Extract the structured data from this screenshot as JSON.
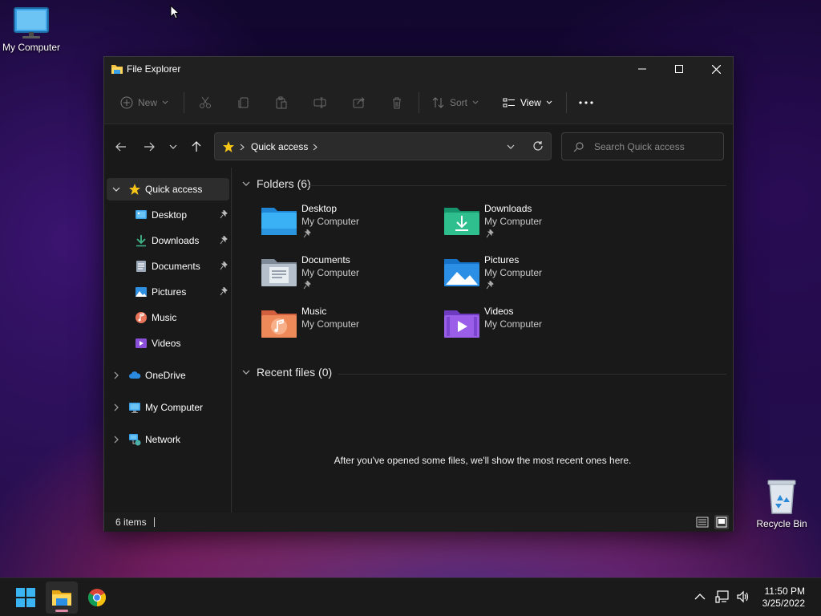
{
  "desktop": {
    "icons": [
      {
        "label": "My Computer"
      },
      {
        "label": "Recycle Bin"
      }
    ]
  },
  "window": {
    "title": "File Explorer",
    "toolbar": {
      "new_label": "New",
      "sort_label": "Sort",
      "view_label": "View"
    },
    "breadcrumb": {
      "location": "Quick access"
    },
    "search": {
      "placeholder": "Search Quick access"
    },
    "sidebar": {
      "quick_access": "Quick access",
      "pinned": [
        "Desktop",
        "Downloads",
        "Documents",
        "Pictures"
      ],
      "unpinned": [
        "Music",
        "Videos"
      ],
      "roots": [
        "OneDrive",
        "My Computer",
        "Network"
      ]
    },
    "folders_header": "Folders (6)",
    "folders": [
      {
        "name": "Desktop",
        "location": "My Computer",
        "pinned": true
      },
      {
        "name": "Downloads",
        "location": "My Computer",
        "pinned": true
      },
      {
        "name": "Documents",
        "location": "My Computer",
        "pinned": true
      },
      {
        "name": "Pictures",
        "location": "My Computer",
        "pinned": true
      },
      {
        "name": "Music",
        "location": "My Computer",
        "pinned": false
      },
      {
        "name": "Videos",
        "location": "My Computer",
        "pinned": false
      }
    ],
    "recent_header": "Recent files (0)",
    "recent_empty": "After you've opened some files, we'll show the most recent ones here.",
    "status": "6 items"
  },
  "taskbar": {
    "time": "11:50 PM",
    "date": "3/25/2022"
  },
  "colors": {
    "window_bg": "#191919",
    "titlebar_bg": "#202020",
    "selection_bg": "#2d2d2d",
    "accent_blue": "#3aa0e8",
    "taskbar_bg": "#1a1a1a"
  }
}
